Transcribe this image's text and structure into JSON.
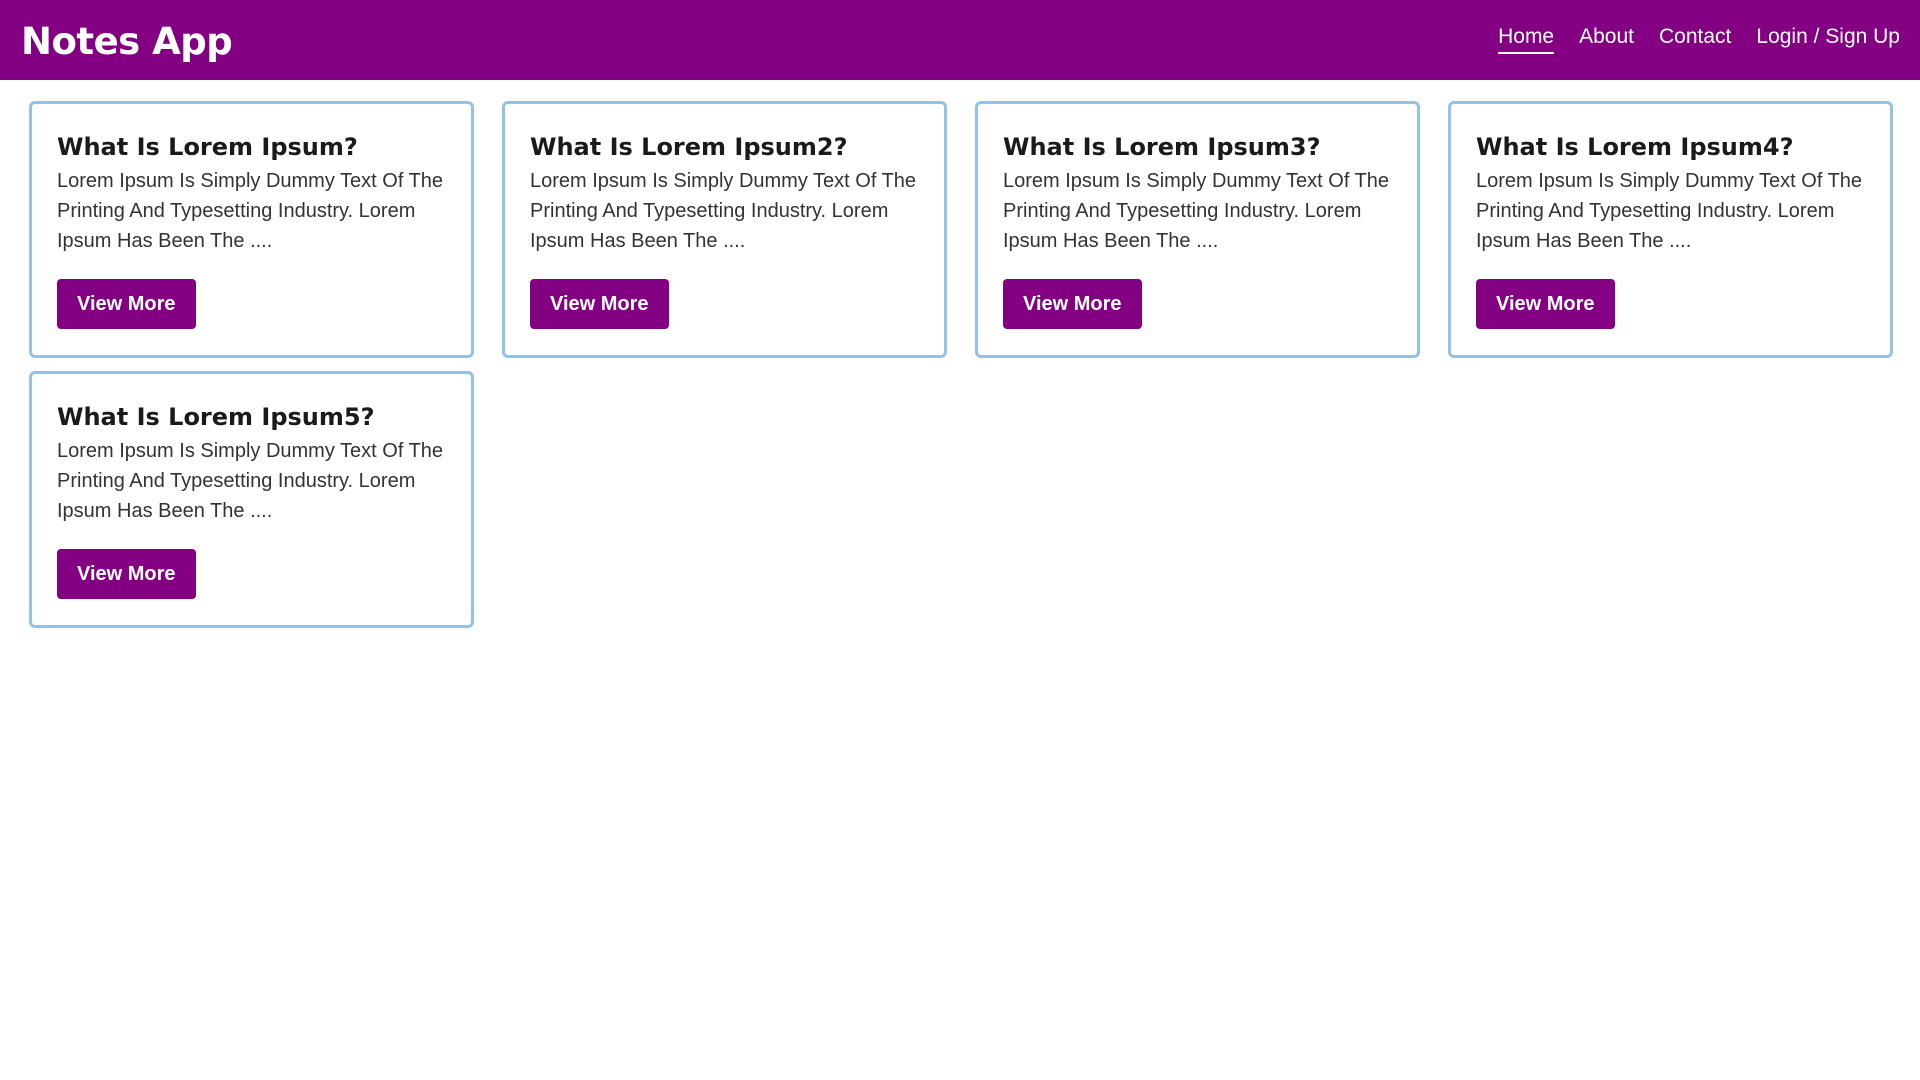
{
  "nav": {
    "brand": "Notes App",
    "links": [
      {
        "label": "Home",
        "active": true
      },
      {
        "label": "About",
        "active": false
      },
      {
        "label": "Contact",
        "active": false
      },
      {
        "label": "Login / Sign Up",
        "active": false
      }
    ]
  },
  "notes": [
    {
      "title": "What Is Lorem Ipsum?",
      "text": "Lorem Ipsum Is Simply Dummy Text Of The Printing And Typesetting Industry. Lorem Ipsum Has Been The ....",
      "button": "View More"
    },
    {
      "title": "What Is Lorem Ipsum2?",
      "text": "Lorem Ipsum Is Simply Dummy Text Of The Printing And Typesetting Industry. Lorem Ipsum Has Been The ....",
      "button": "View More"
    },
    {
      "title": "What Is Lorem Ipsum3?",
      "text": "Lorem Ipsum Is Simply Dummy Text Of The Printing And Typesetting Industry. Lorem Ipsum Has Been The ....",
      "button": "View More"
    },
    {
      "title": "What Is Lorem Ipsum4?",
      "text": "Lorem Ipsum Is Simply Dummy Text Of The Printing And Typesetting Industry. Lorem Ipsum Has Been The ....",
      "button": "View More"
    },
    {
      "title": "What Is Lorem Ipsum5?",
      "text": "Lorem Ipsum Is Simply Dummy Text Of The Printing And Typesetting Industry. Lorem Ipsum Has Been The ....",
      "button": "View More"
    }
  ],
  "colors": {
    "brand": "#830083",
    "card_border": "#90c2ec",
    "text": "#333333"
  }
}
